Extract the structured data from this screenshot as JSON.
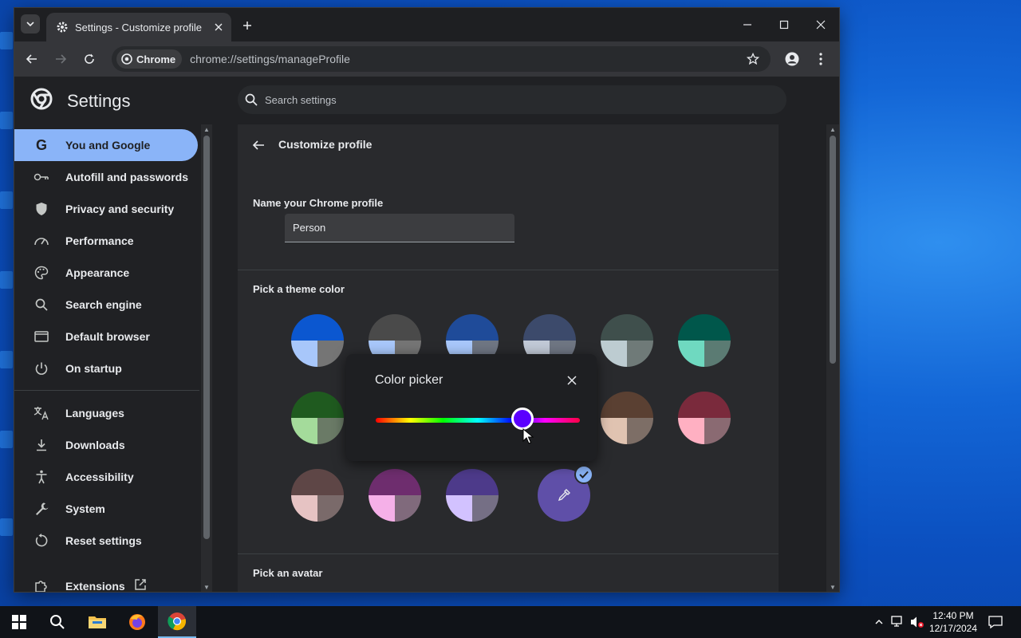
{
  "browser": {
    "tab_title": "Settings - Customize profile",
    "chip_label": "Chrome",
    "url": "chrome://settings/manageProfile"
  },
  "settings": {
    "title": "Settings",
    "search_placeholder": "Search settings"
  },
  "sidebar": {
    "items": [
      {
        "label": "You and Google",
        "icon": "google-icon"
      },
      {
        "label": "Autofill and passwords",
        "icon": "key-icon"
      },
      {
        "label": "Privacy and security",
        "icon": "shield-icon"
      },
      {
        "label": "Performance",
        "icon": "speedometer-icon"
      },
      {
        "label": "Appearance",
        "icon": "palette-icon"
      },
      {
        "label": "Search engine",
        "icon": "search-icon"
      },
      {
        "label": "Default browser",
        "icon": "browser-window-icon"
      },
      {
        "label": "On startup",
        "icon": "power-icon"
      },
      {
        "label": "Languages",
        "icon": "translate-icon"
      },
      {
        "label": "Downloads",
        "icon": "download-icon"
      },
      {
        "label": "Accessibility",
        "icon": "accessibility-icon"
      },
      {
        "label": "System",
        "icon": "wrench-icon"
      },
      {
        "label": "Reset settings",
        "icon": "reset-icon"
      },
      {
        "label": "Extensions",
        "icon": "puzzle-icon"
      }
    ]
  },
  "main": {
    "page_title": "Customize profile",
    "name_section": "Name your Chrome profile",
    "name_value": "Person",
    "theme_section": "Pick a theme color",
    "avatar_section": "Pick an avatar",
    "swatches": [
      {
        "top": "#0b57d0",
        "bl": "#a8c7fa",
        "br": "#757575"
      },
      {
        "top": "#4a4a4a",
        "bl": "#a8c7fa",
        "br": "#757575"
      },
      {
        "top": "#1f4b99",
        "bl": "#a8c7fa",
        "br": "#6f7683"
      },
      {
        "top": "#3c4a6b",
        "bl": "#c1c9d6",
        "br": "#6f7683"
      },
      {
        "top": "#3f4f4c",
        "bl": "#bdccd1",
        "br": "#6f7a78"
      },
      {
        "top": "#00574b",
        "bl": "#6fd9c0",
        "br": "#5b7b73"
      },
      {
        "top": "#1f5a1f",
        "bl": "#a4db9b",
        "br": "#6a7a66"
      },
      {
        "top": "#5a4032",
        "bl": "#e0c3b1",
        "br": "#7d6e66"
      },
      {
        "top": "#7a2a3c",
        "bl": "#ffb0c2",
        "br": "#8a6a72"
      },
      {
        "top": "#5e4646",
        "bl": "#e6c3c3",
        "br": "#7a6a6a"
      },
      {
        "top": "#6e2d6e",
        "bl": "#f5b0e8",
        "br": "#806a7c"
      },
      {
        "top": "#4d3a8a",
        "bl": "#d2c2ff",
        "br": "#756f85"
      }
    ],
    "custom_color": "#5f4fa8",
    "avatar_colors": [
      "#2d5fa8",
      "#b0c4f0",
      "#f5e36a",
      "#e8eaed",
      "#f2a8b8",
      "#f0f0f0"
    ]
  },
  "color_picker": {
    "title": "Color picker",
    "hue_fraction": 0.72,
    "thumb_color": "#5b00ff"
  },
  "taskbar": {
    "time": "12:40 PM",
    "date": "12/17/2024"
  }
}
